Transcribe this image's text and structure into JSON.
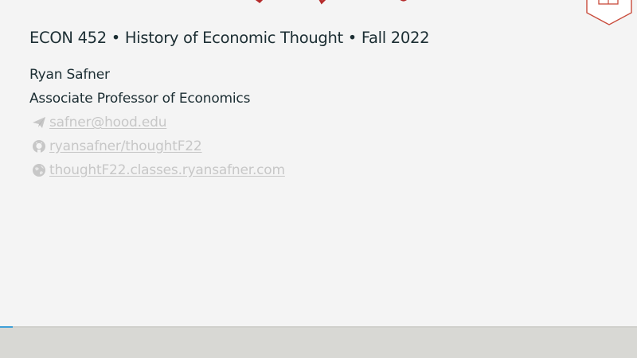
{
  "slide": {
    "course_line": "ECON 452 • History of Economic Thought • Fall 2022",
    "author": "Ryan Safner",
    "role": "Associate Professor of Economics",
    "links": {
      "email": "safner@hood.edu",
      "github": "ryansafner/thoughtF22",
      "website": "thoughtF22.classes.ryansafner.com"
    },
    "icons": {
      "email": "paper-plane-icon",
      "github": "github-icon",
      "website": "globe-icon",
      "logo": "open-book-logo"
    }
  },
  "progress": {
    "fraction": 0.02
  },
  "colors": {
    "title_red": "#b52a2a",
    "text": "#1c2e33",
    "link": "#c7c7c7",
    "progress": "#3fa0d8",
    "background": "#f4f4f4",
    "footer": "#d8d8d4"
  }
}
